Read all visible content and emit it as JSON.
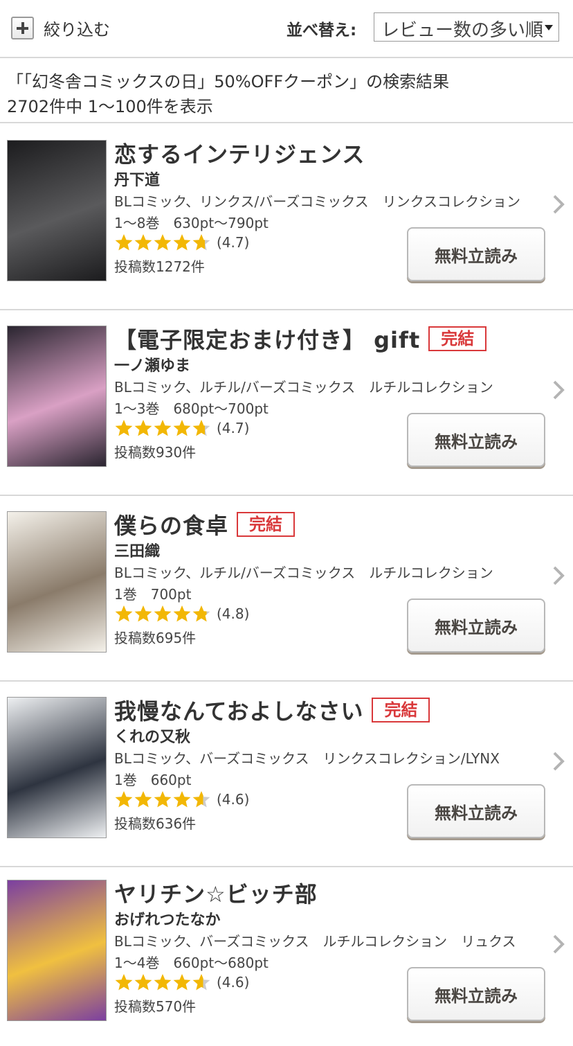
{
  "header": {
    "filter_label": "絞り込む",
    "sort_label": "並べ替え:",
    "sort_value": "レビュー数の多い順"
  },
  "summary": {
    "query": "「「幻冬舎コミックスの日」50%OFFクーポン」の検索結果",
    "count": "2702件中 1〜100件を表示"
  },
  "items": [
    {
      "title": "恋するインテリジェンス",
      "badge": "",
      "author": "丹下道",
      "labels": "BLコミック、リンクス/バーズコミックス　リンクスコレクション",
      "price": "1〜8巻　630pt〜790pt",
      "rating": 4.7,
      "rating_text": "(4.7)",
      "reviews": "投稿数1272件",
      "button": "無料立読み",
      "cover_colors": [
        "#1c1c1e",
        "#5a5a5c"
      ]
    },
    {
      "title": "【電子限定おまけ付き】 gift",
      "badge": "完結",
      "author": "一ノ瀬ゆま",
      "labels": "BLコミック、ルチル/バーズコミックス　ルチルコレクション",
      "price": "1〜3巻　680pt〜700pt",
      "rating": 4.7,
      "rating_text": "(4.7)",
      "reviews": "投稿数930件",
      "button": "無料立読み",
      "cover_colors": [
        "#2a2530",
        "#d9a0c4"
      ]
    },
    {
      "title": "僕らの食卓",
      "badge": "完結",
      "author": "三田織",
      "labels": "BLコミック、ルチル/バーズコミックス　ルチルコレクション",
      "price": "1巻　700pt",
      "rating": 4.8,
      "rating_text": "(4.8)",
      "reviews": "投稿数695件",
      "button": "無料立読み",
      "cover_colors": [
        "#f4f1ea",
        "#8a7b6a"
      ]
    },
    {
      "title": "我慢なんておよしなさい",
      "badge": "完結",
      "author": "くれの又秋",
      "labels": "BLコミック、バーズコミックス　リンクスコレクション/LYNX",
      "price": "1巻　660pt",
      "rating": 4.6,
      "rating_text": "(4.6)",
      "reviews": "投稿数636件",
      "button": "無料立読み",
      "cover_colors": [
        "#eef0f2",
        "#2e3440"
      ]
    },
    {
      "title": "ヤリチン☆ビッチ部",
      "badge": "",
      "author": "おげれつたなか",
      "labels": "BLコミック、バーズコミックス　ルチルコレクション　リュクス",
      "price": "1〜4巻　660pt〜680pt",
      "rating": 4.6,
      "rating_text": "(4.6)",
      "reviews": "投稿数570件",
      "button": "無料立読み",
      "cover_colors": [
        "#7b3fa0",
        "#f0c040"
      ]
    }
  ],
  "colors": {
    "star": "#f2b705",
    "star_empty": "#cccccc",
    "badge": "#d9383a",
    "divider": "#d8d8d8"
  },
  "icons": [
    "plus-icon",
    "dropdown-arrow-icon",
    "star-icon",
    "chevron-right-icon"
  ]
}
